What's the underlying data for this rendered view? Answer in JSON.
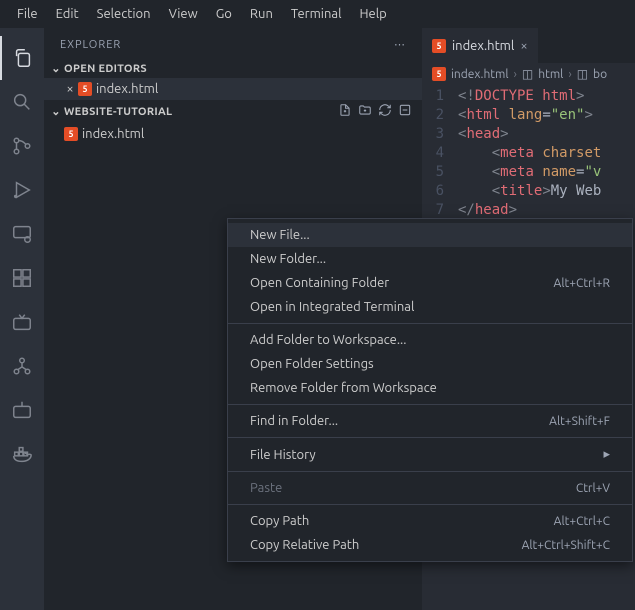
{
  "menubar": [
    "File",
    "Edit",
    "Selection",
    "View",
    "Go",
    "Run",
    "Terminal",
    "Help"
  ],
  "sidebar": {
    "title": "EXPLORER",
    "open_editors_label": "OPEN EDITORS",
    "folder_label": "WEBSITE-TUTORIAL",
    "open_file": "index.html",
    "tree_file": "index.html"
  },
  "tab": {
    "name": "index.html"
  },
  "breadcrumbs": {
    "file": "index.html",
    "seg1": "html",
    "seg2": "bo"
  },
  "code": {
    "lines": [
      1,
      2,
      3,
      4,
      5,
      6,
      7
    ],
    "line1": {
      "open": "<!",
      "doctype": "DOCTYPE ",
      "html": "html",
      "close": ">"
    },
    "line2": {
      "open": "<",
      "tag": "html ",
      "attr": "lang",
      "eq": "=",
      "val": "\"en\"",
      "close": ">"
    },
    "line3": {
      "open": "<",
      "tag": "head",
      "close": ">"
    },
    "line4": {
      "open": "<",
      "tag": "meta ",
      "attr": "charset"
    },
    "line5": {
      "open": "<",
      "tag": "meta ",
      "attr": "name",
      "eq": "=",
      "val": "\"v"
    },
    "line6": {
      "open": "<",
      "tag": "title",
      "close": ">",
      "text": "My Web"
    },
    "line7": {
      "open": "</",
      "tag": "head",
      "close": ">"
    }
  },
  "context_menu": {
    "groups": [
      [
        {
          "label": "New File...",
          "highlight": true
        },
        {
          "label": "New Folder..."
        },
        {
          "label": "Open Containing Folder",
          "shortcut": "Alt+Ctrl+R"
        },
        {
          "label": "Open in Integrated Terminal"
        }
      ],
      [
        {
          "label": "Add Folder to Workspace..."
        },
        {
          "label": "Open Folder Settings"
        },
        {
          "label": "Remove Folder from Workspace"
        }
      ],
      [
        {
          "label": "Find in Folder...",
          "shortcut": "Alt+Shift+F"
        }
      ],
      [
        {
          "label": "File History",
          "submenu": true
        }
      ],
      [
        {
          "label": "Paste",
          "shortcut": "Ctrl+V",
          "disabled": true
        }
      ],
      [
        {
          "label": "Copy Path",
          "shortcut": "Alt+Ctrl+C"
        },
        {
          "label": "Copy Relative Path",
          "shortcut": "Alt+Ctrl+Shift+C"
        }
      ]
    ]
  }
}
